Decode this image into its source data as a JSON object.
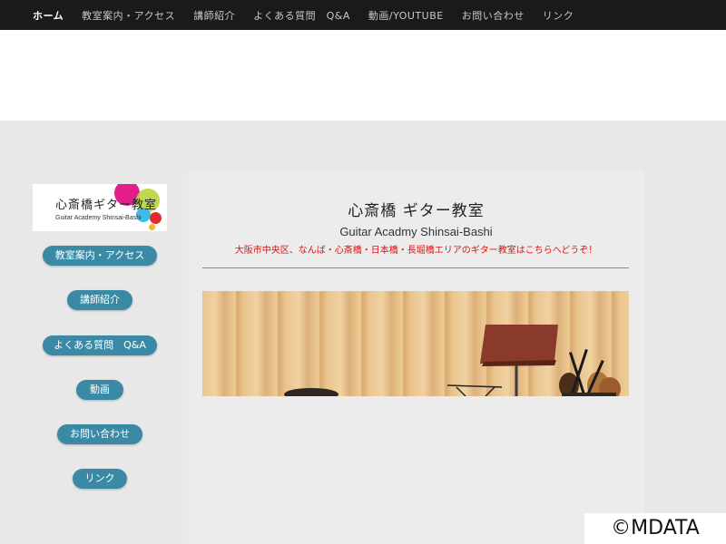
{
  "nav": {
    "items": [
      "ホーム",
      "教室案内・アクセス",
      "講師紹介",
      "よくある質問　Q&A",
      "動画/YOUTUBE",
      "お問い合わせ",
      "リンク"
    ],
    "active_index": 0
  },
  "logo": {
    "title_ja": "心斎橋ギター教室",
    "title_en": "Guitar Academy Shinsai-Bashi",
    "colors": [
      "#e21e8a",
      "#b9d43c",
      "#3bbde8",
      "#e32b2b",
      "#f3b81f"
    ]
  },
  "sidebar": {
    "buttons": [
      "教室案内・アクセス",
      "講師紹介",
      "よくある質問　Q&A",
      "動画",
      "お問い合わせ",
      "リンク"
    ],
    "button_color": "#3b8aa5"
  },
  "main": {
    "title": "心斎橋 ギター教室",
    "subtitle": "Guitar Acadmy Shinsai-Bashi",
    "tagline": "大阪市中央区、なんば・心斎橋・日本橋・長堀橋エリアのギター教室はこちらへどうぞ！",
    "tagline_color": "#e01010"
  },
  "credit": "©MDATA"
}
